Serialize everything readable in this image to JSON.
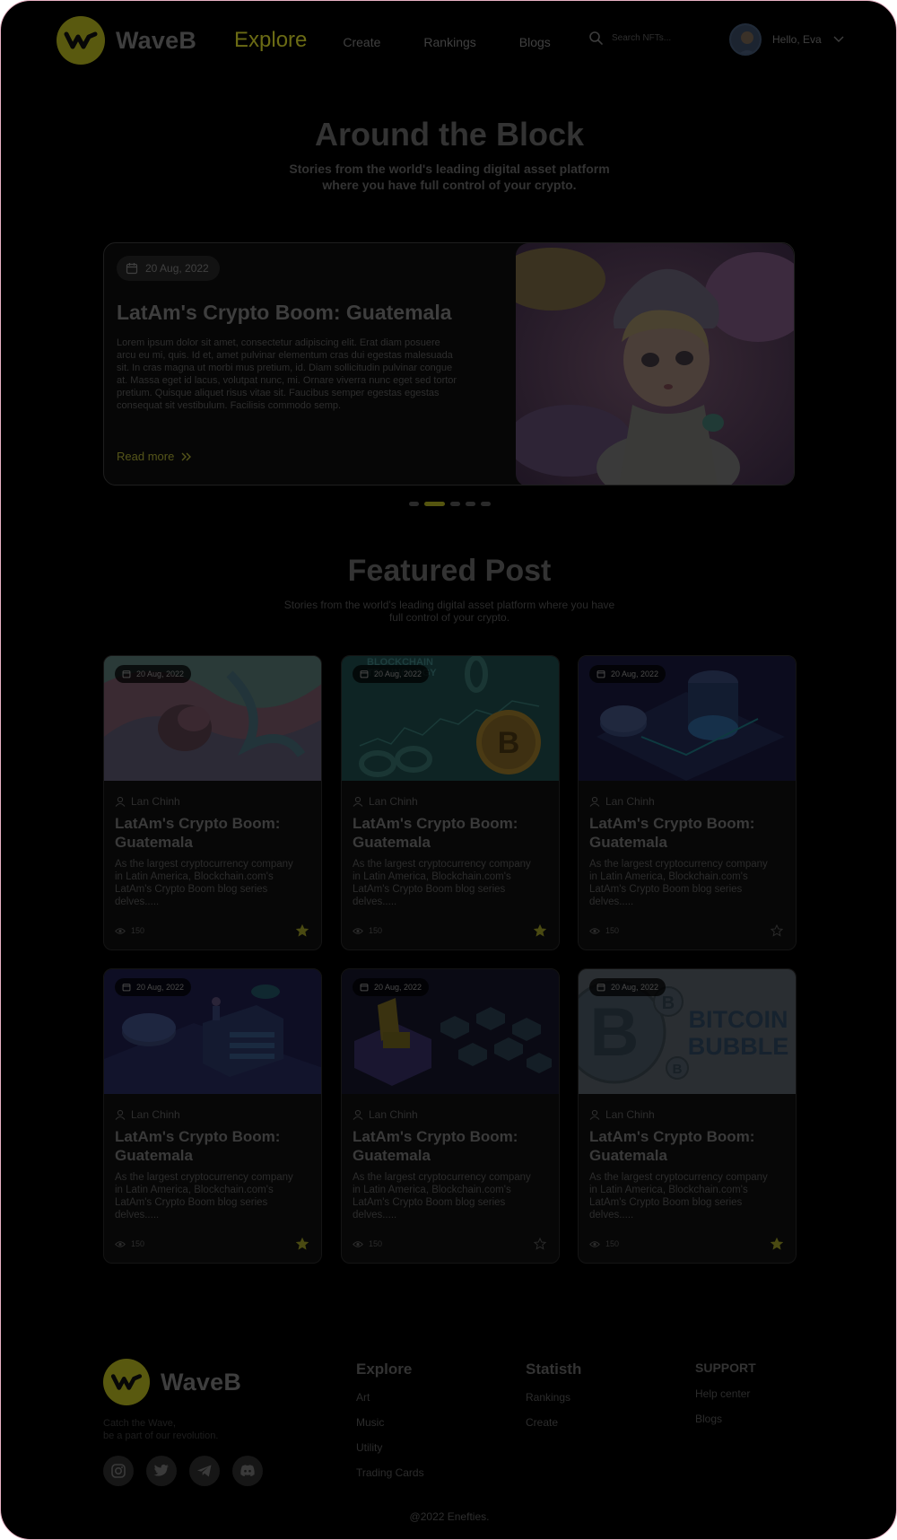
{
  "brand": {
    "name": "WaveB",
    "accent": "#6b6b14"
  },
  "nav": {
    "active": "Explore",
    "items": [
      "Create",
      "Rankings",
      "Blogs"
    ]
  },
  "search": {
    "placeholder": "Search NFTs..."
  },
  "user": {
    "greeting": "Hello, Eva"
  },
  "hero": {
    "title": "Around the Block",
    "subtitle": "Stories from the world's leading digital asset platform where you have full control of your crypto."
  },
  "slide": {
    "date": "20 Aug, 2022",
    "title": "LatAm's Crypto Boom: Guatemala",
    "body": "Lorem ipsum dolor sit amet, consectetur adipiscing elit. Erat diam posuere arcu eu mi, quis. Id et, amet pulvinar elementum cras dui egestas malesuada sit. In cras magna ut morbi mus pretium, id. Diam sollicitudin pulvinar congue at. Massa eget id lacus, volutpat nunc, mi. Ornare viverra nunc eget sed tortor pretium. Quisque aliquet risus vitae sit. Faucibus semper egestas egestas consequat sit vestibulum. Facilisis commodo semp.",
    "read_more": "Read more",
    "dots": 5,
    "active_dot": 1
  },
  "featured": {
    "title": "Featured Post",
    "subtitle": "Stories from the world's leading digital asset platform where you have full control of your crypto."
  },
  "cards": [
    {
      "date": "20 Aug, 2022",
      "author": "Lan Chinh",
      "title": "LatAm's Crypto Boom: Guatemala",
      "body": "As the largest cryptocurrency company in Latin America, Blockchain.com's LatAm's Crypto Boom blog series delves.....",
      "views": "150",
      "starred": true
    },
    {
      "date": "20 Aug, 2022",
      "author": "Lan Chinh",
      "title": "LatAm's Crypto Boom: Guatemala",
      "body": "As the largest cryptocurrency company in Latin America, Blockchain.com's LatAm's Crypto Boom blog series delves.....",
      "views": "150",
      "starred": true
    },
    {
      "date": "20 Aug, 2022",
      "author": "Lan Chinh",
      "title": "LatAm's Crypto Boom: Guatemala",
      "body": "As the largest cryptocurrency company in Latin America, Blockchain.com's LatAm's Crypto Boom blog series delves.....",
      "views": "150",
      "starred": false
    },
    {
      "date": "20 Aug, 2022",
      "author": "Lan Chinh",
      "title": "LatAm's Crypto Boom: Guatemala",
      "body": "As the largest cryptocurrency company in Latin America, Blockchain.com's LatAm's Crypto Boom blog series delves.....",
      "views": "150",
      "starred": true
    },
    {
      "date": "20 Aug, 2022",
      "author": "Lan Chinh",
      "title": "LatAm's Crypto Boom: Guatemala",
      "body": "As the largest cryptocurrency company in Latin America, Blockchain.com's LatAm's Crypto Boom blog series delves.....",
      "views": "150",
      "starred": false
    },
    {
      "date": "20 Aug, 2022",
      "author": "Lan Chinh",
      "title": "LatAm's Crypto Boom: Guatemala",
      "body": "As the largest cryptocurrency company in Latin America, Blockchain.com's LatAm's Crypto Boom blog series delves.....",
      "views": "150",
      "starred": true
    }
  ],
  "card_images": [
    "wavy-abstract",
    "blockchain-technology",
    "isometric-coins",
    "isometric-server",
    "isometric-blocks",
    "bitcoin-bubble"
  ],
  "bitcoin_bubble_text": [
    "BITCOIN",
    "BUBBLE"
  ],
  "blockchain_text": [
    "BLOCKCHAIN",
    "TECHNOLOGY"
  ],
  "footer": {
    "tagline": [
      "Catch the Wave,",
      "be a part of our revolution."
    ],
    "socials": [
      "instagram-icon",
      "twitter-icon",
      "telegram-icon",
      "discord-icon"
    ],
    "columns": [
      {
        "title": "Explore",
        "links": [
          "Art",
          "Music",
          "Utility",
          "Trading Cards"
        ]
      },
      {
        "title": "Statisth",
        "links": [
          "Rankings",
          "Create"
        ]
      },
      {
        "title": "SUPPORT",
        "links": [
          "Help center",
          "Blogs"
        ]
      }
    ],
    "copyright": "@2022 Enefties."
  }
}
